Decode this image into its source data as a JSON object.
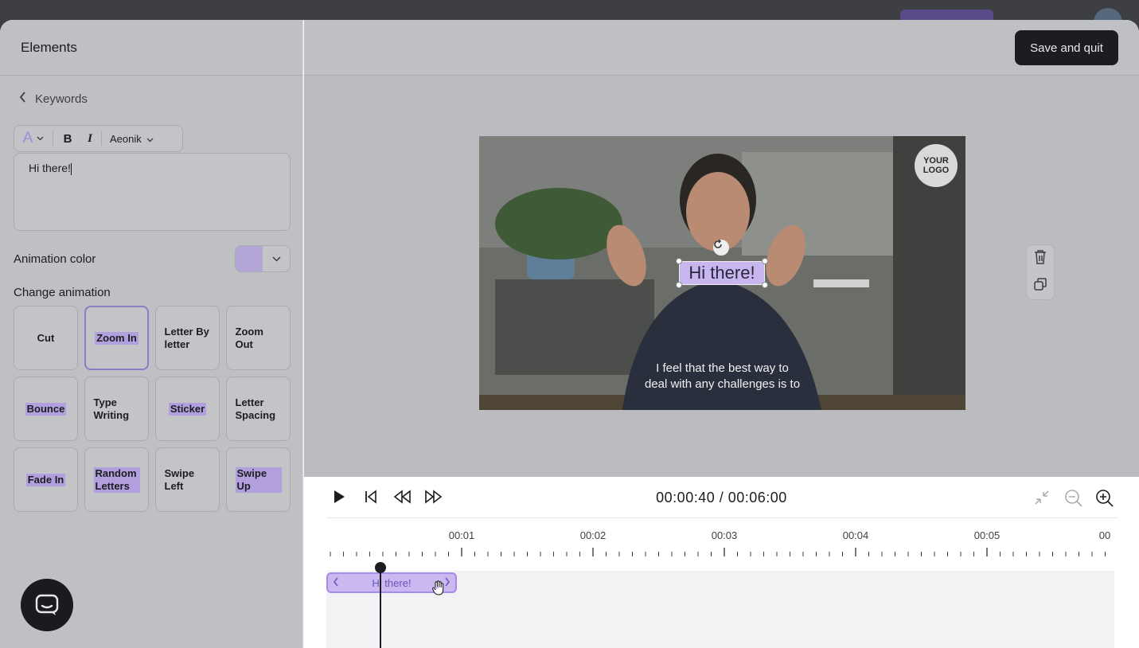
{
  "panel": {
    "title": "Elements",
    "back_label": "Keywords",
    "toolbar": {
      "text_color_icon": "A",
      "bold": "B",
      "italic": "I",
      "font_name": "Aeonik"
    },
    "text_value": "Hi there!",
    "animation_color_label": "Animation color",
    "animation_color": "#b3a6d6",
    "change_animation_label": "Change animation",
    "animations": [
      {
        "label": "Cut",
        "selected": false
      },
      {
        "label": "Zoom In",
        "selected": true
      },
      {
        "label": "Letter By letter",
        "selected": false
      },
      {
        "label": "Zoom Out",
        "selected": false
      },
      {
        "label": "Bounce",
        "selected": false
      },
      {
        "label": "Type Writing",
        "selected": false
      },
      {
        "label": "Sticker",
        "selected": false
      },
      {
        "label": "Letter Spacing",
        "selected": false
      },
      {
        "label": "Fade In",
        "selected": false
      },
      {
        "label": "Random Letters",
        "selected": false
      },
      {
        "label": "Swipe Left",
        "selected": false
      },
      {
        "label": "Swipe Up",
        "selected": false
      }
    ]
  },
  "header": {
    "save_label": "Save and quit"
  },
  "video": {
    "logo_text": "YOUR LOGO",
    "overlay_text": "Hi there!",
    "subtitle_line1": "I feel that the best way to",
    "subtitle_line2": "deal with any challenges is to"
  },
  "timeline": {
    "current_time": "00:00:40",
    "total_time": "00:06:00",
    "time_separator": " / ",
    "tick_labels": [
      "00:01",
      "00:02",
      "00:03",
      "00:04",
      "00:05",
      "00"
    ],
    "clip_label": "Hi there!"
  },
  "colors": {
    "accent": "#a68bea",
    "dark": "#1c1d21",
    "highlight": "#b1a0dd"
  }
}
